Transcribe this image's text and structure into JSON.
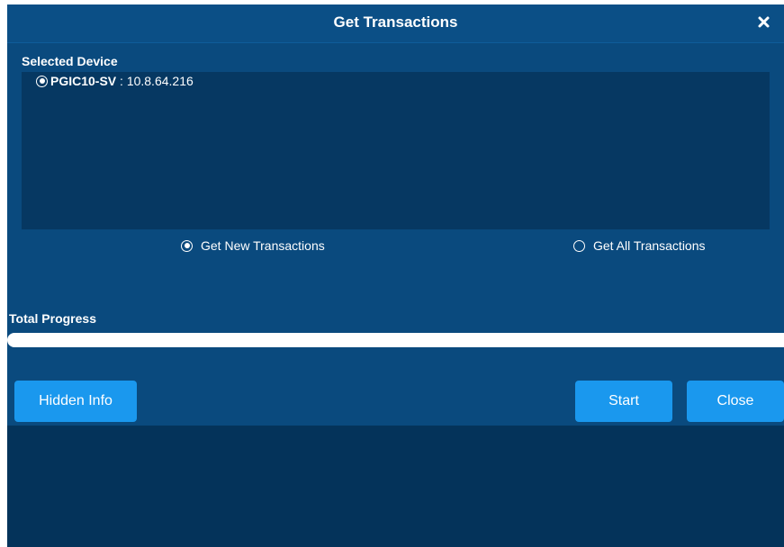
{
  "dialog": {
    "title": "Get Transactions",
    "close_icon": "close-icon"
  },
  "device_section": {
    "label": "Selected Device",
    "devices": [
      {
        "name": "PGIC10-SV",
        "separator": " : ",
        "ip": "10.8.64.216",
        "selected": true
      }
    ]
  },
  "options": {
    "new_label": "Get New Transactions",
    "all_label": "Get All Transactions",
    "selected": "new"
  },
  "progress": {
    "label": "Total Progress",
    "value": 1.0
  },
  "buttons": {
    "hidden_info": "Hidden Info",
    "start": "Start",
    "close": "Close"
  },
  "colors": {
    "titlebar": "#0b4f86",
    "body": "#0a4a7e",
    "device_box": "#063862",
    "footer": "#04335a",
    "button": "#1a98ee"
  }
}
